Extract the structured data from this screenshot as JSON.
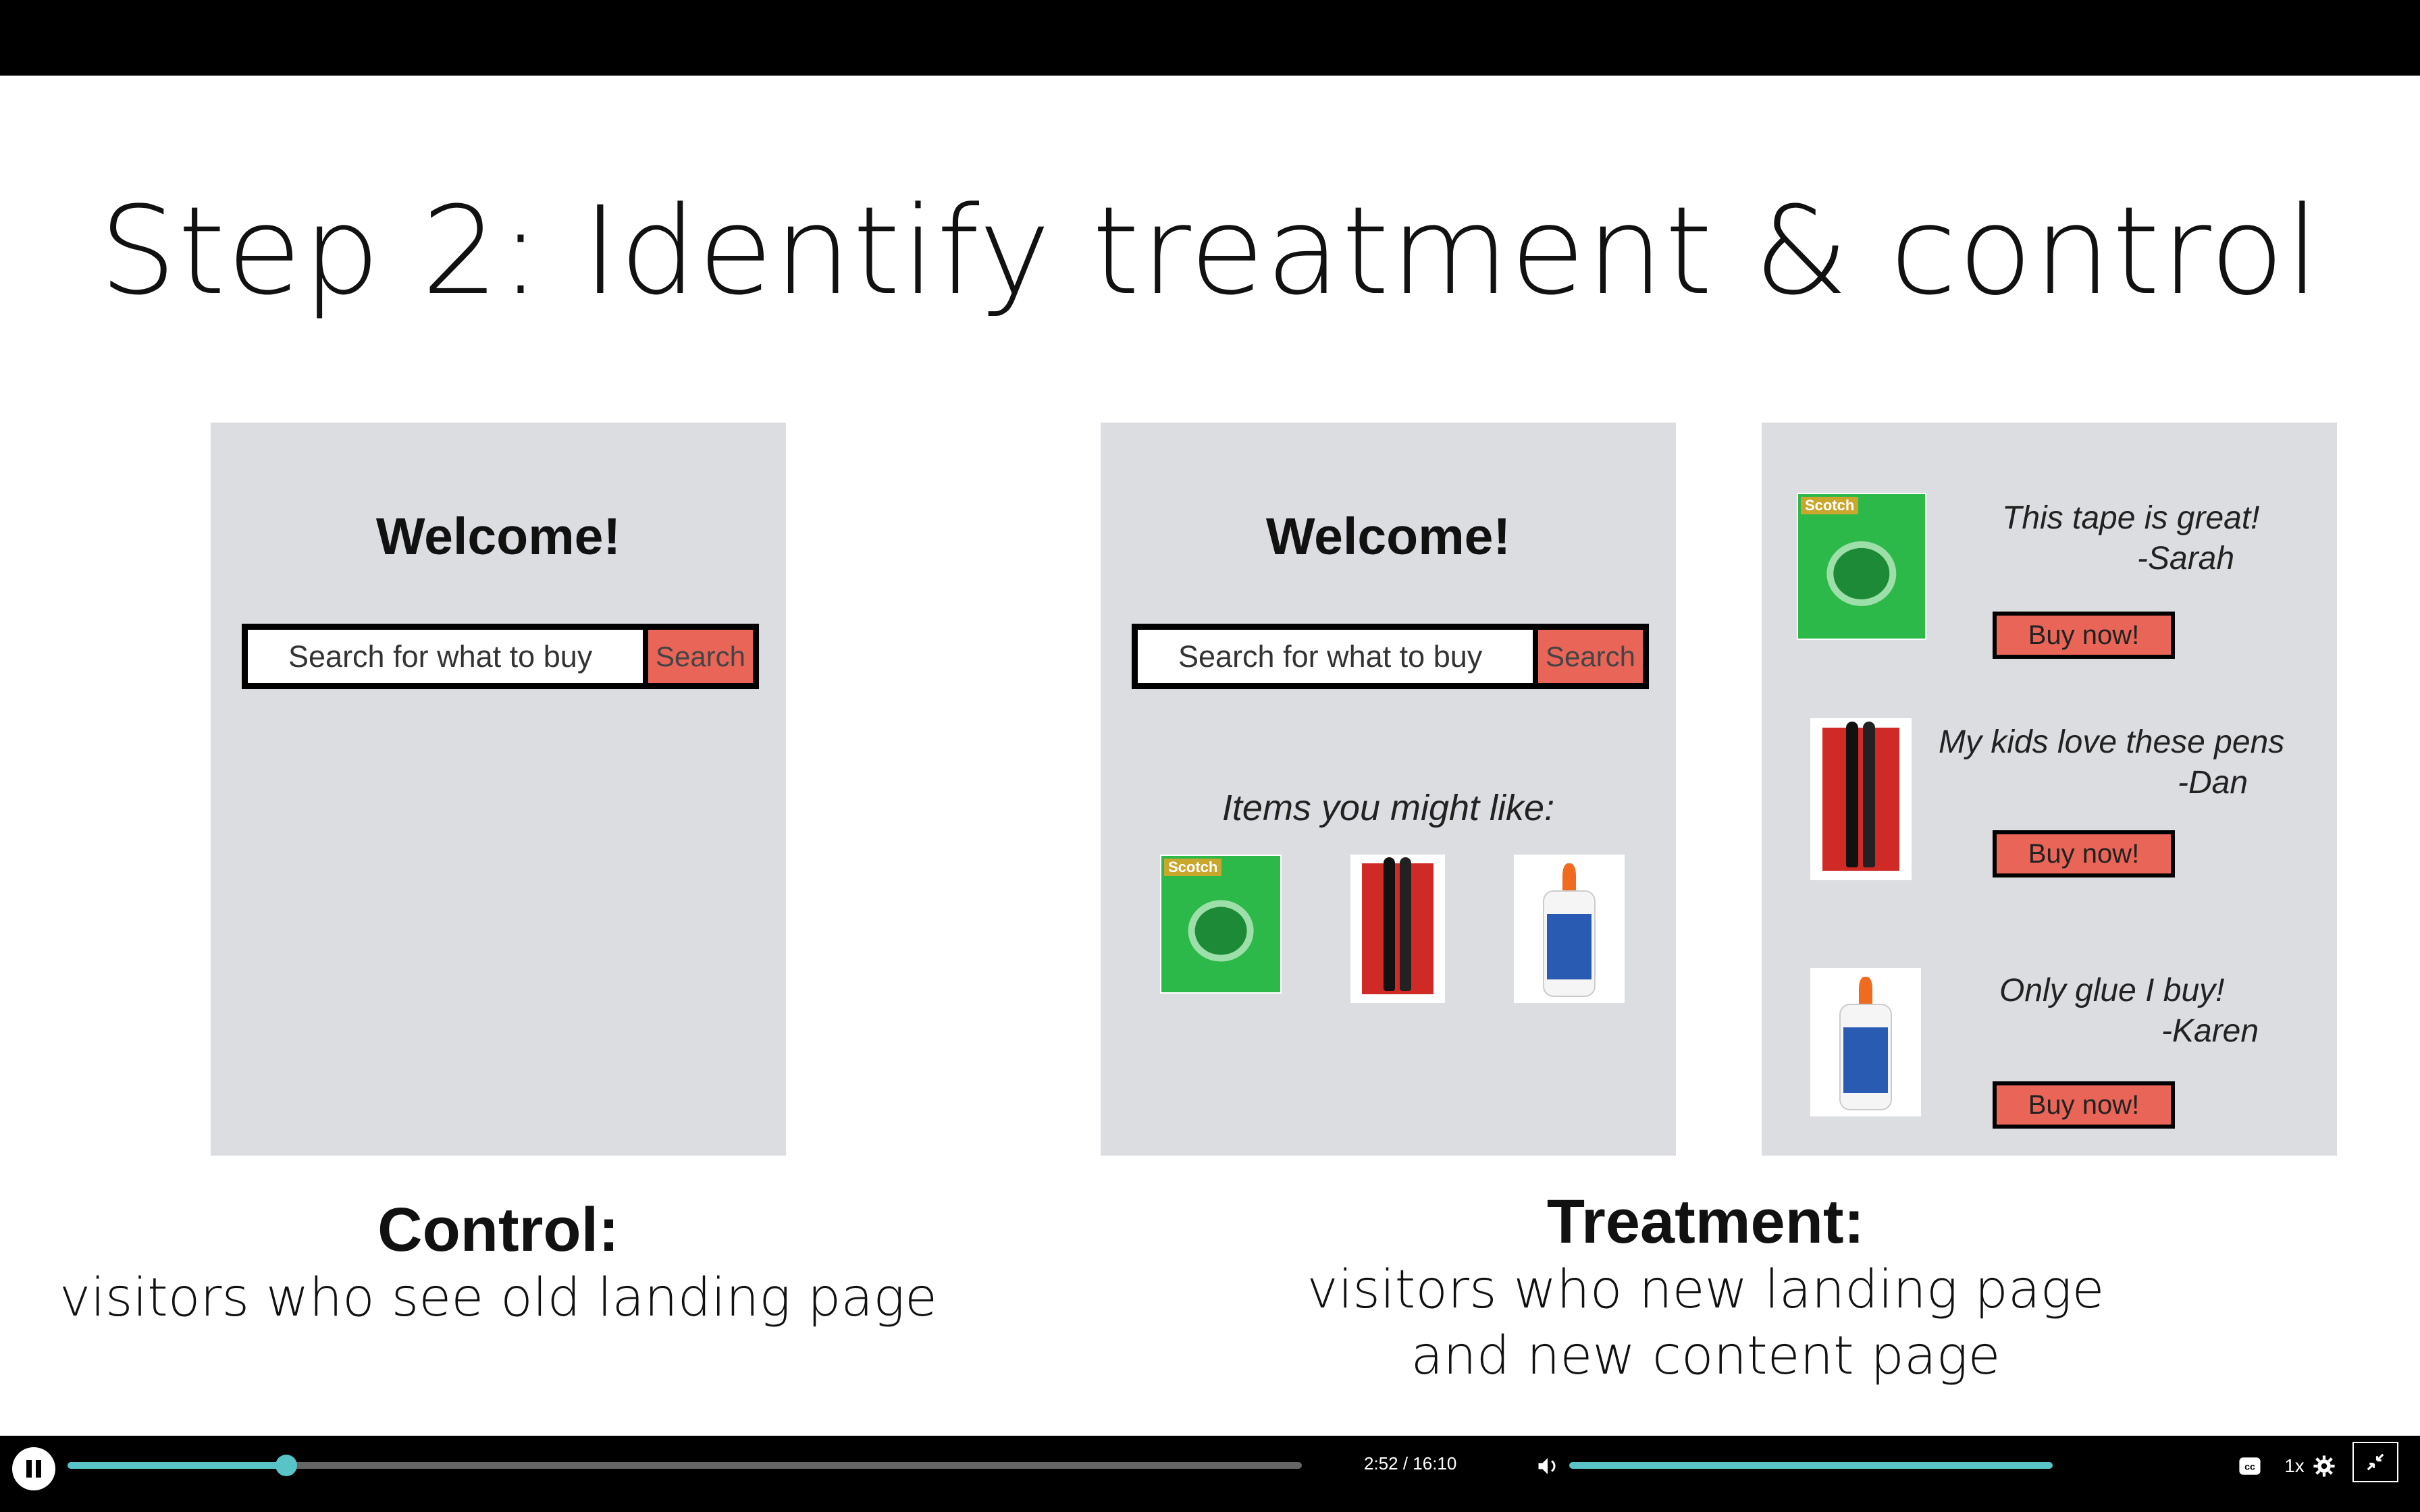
{
  "slide": {
    "title": "Step 2: Identify treatment & control",
    "control_panel": {
      "welcome": "Welcome!",
      "search_placeholder": "Search for what to buy",
      "search_button": "Search"
    },
    "treatment_landing": {
      "welcome": "Welcome!",
      "search_placeholder": "Search for what to buy",
      "search_button": "Search",
      "items_label": "Items you might like:"
    },
    "treatment_content": {
      "reviews": [
        {
          "quote": "This tape is great!",
          "author": "-Sarah",
          "button": "Buy now!"
        },
        {
          "quote": "My kids love these pens",
          "author": "-Dan",
          "button": "Buy now!"
        },
        {
          "quote": "Only glue I buy!",
          "author": "-Karen",
          "button": "Buy now!"
        }
      ],
      "product_brand": "Scotch"
    },
    "control_caption": {
      "heading": "Control:",
      "text": "visitors who see old landing page"
    },
    "treatment_caption": {
      "heading": "Treatment:",
      "line1": "visitors who new landing page",
      "line2": "and new content page"
    }
  },
  "player": {
    "current_time": "2:52",
    "duration": "16:10",
    "time_display": "2:52 / 16:10",
    "progress": 0.177,
    "volume": 1.0,
    "speed": "1x",
    "accent_color": "#58c4c8",
    "icons": [
      "pause-icon",
      "volume-icon",
      "captions-icon",
      "settings-icon",
      "exit-fullscreen-icon"
    ]
  }
}
